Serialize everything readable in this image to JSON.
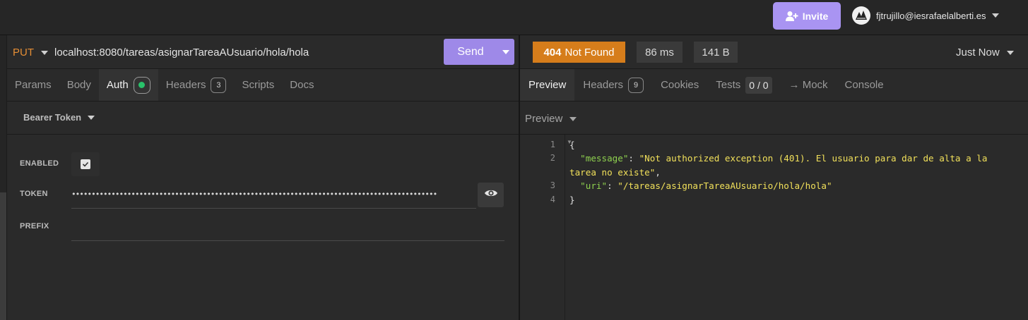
{
  "topbar": {
    "invite_label": "Invite",
    "account_email": "fjtrujillo@iesrafaelalberti.es"
  },
  "request": {
    "method": "PUT",
    "url": "localhost:8080/tareas/asignarTareaAUsuario/hola/hola",
    "send_label": "Send",
    "tabs": [
      {
        "label": "Params"
      },
      {
        "label": "Body"
      },
      {
        "label": "Auth"
      },
      {
        "label": "Headers",
        "count": "3"
      },
      {
        "label": "Scripts"
      },
      {
        "label": "Docs"
      }
    ],
    "active_tab": "Auth",
    "auth": {
      "type_label": "Bearer Token",
      "enabled_label": "ENABLED",
      "enabled": true,
      "token_label": "TOKEN",
      "token_mask": "••••••••••••••••••••••••••••••••••••••••••••••••••••••••••••••••••••••••••••••••••••••••••••",
      "prefix_label": "PREFIX"
    }
  },
  "response": {
    "status_code": "404",
    "status_text": "Not Found",
    "time": "86 ms",
    "size": "141 B",
    "history_label": "Just Now",
    "tabs": [
      {
        "label": "Preview"
      },
      {
        "label": "Headers",
        "count": "9"
      },
      {
        "label": "Cookies"
      },
      {
        "label": "Tests",
        "count": "0 / 0"
      },
      {
        "label": "→ Mock"
      },
      {
        "label": "Console"
      }
    ],
    "active_tab": "Preview",
    "preview_mode": "Preview",
    "line_numbers": [
      "1",
      "2",
      "3",
      "4"
    ],
    "body": {
      "open_brace": "{",
      "message_key": "\"message\"",
      "message_value_1": "\"Not authorized exception (401). El usuario para dar de alta a la",
      "message_value_2": "tarea no existe\"",
      "uri_key": "\"uri\"",
      "uri_value": "\"/tareas/asignarTareaAUsuario/hola/hola\"",
      "close_brace": "}"
    }
  },
  "colors": {
    "accent_purple": "#9e89e8",
    "status_orange": "#d67d1b",
    "method_orange": "#e58e35",
    "json_key": "#8fd14f",
    "json_string": "#f1e05a"
  }
}
